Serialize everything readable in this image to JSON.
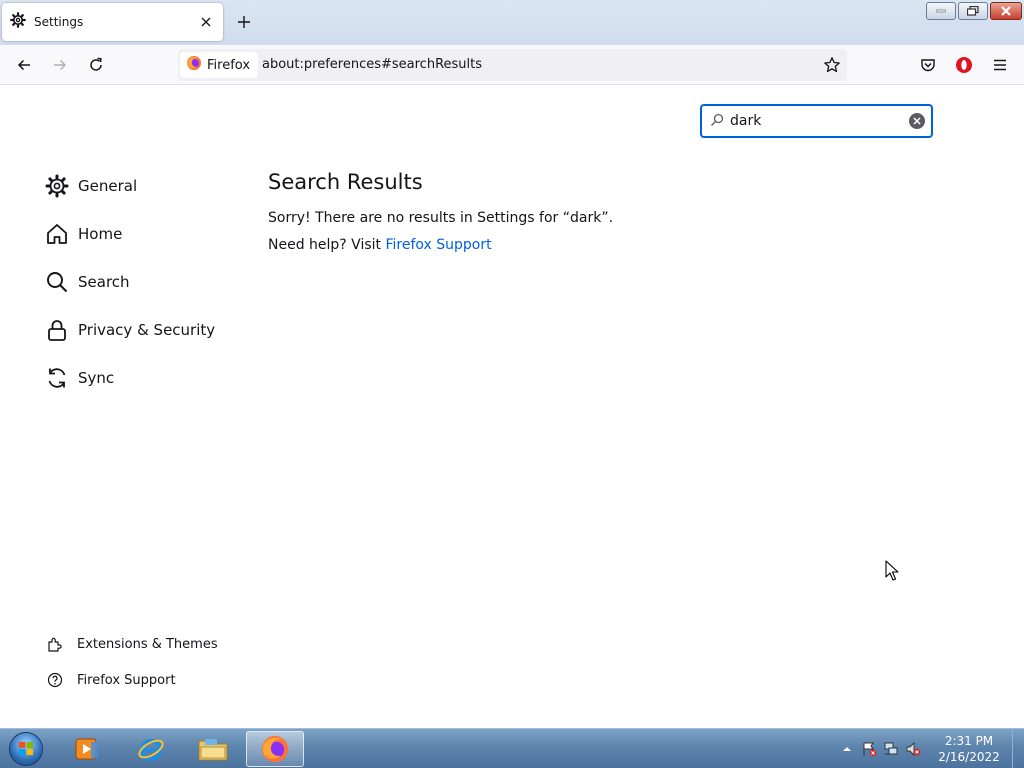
{
  "tab": {
    "title": "Settings",
    "icon": "gear-icon"
  },
  "toolbar": {
    "identity_label": "Firefox",
    "url": "about:preferences#searchResults"
  },
  "search": {
    "value": "dark"
  },
  "sidebar": {
    "items": [
      {
        "label": "General",
        "icon": "gear-icon"
      },
      {
        "label": "Home",
        "icon": "home-icon"
      },
      {
        "label": "Search",
        "icon": "magnifier-icon"
      },
      {
        "label": "Privacy & Security",
        "icon": "lock-icon"
      },
      {
        "label": "Sync",
        "icon": "sync-icon"
      }
    ],
    "footer": [
      {
        "label": "Extensions & Themes",
        "icon": "puzzle-icon"
      },
      {
        "label": "Firefox Support",
        "icon": "help-icon"
      }
    ]
  },
  "results": {
    "heading": "Search Results",
    "sorry": "Sorry! There are no results in Settings for “dark”.",
    "help_prefix": "Need help? Visit ",
    "help_link": "Firefox Support"
  },
  "taskbar": {
    "apps": [
      "media-player-icon",
      "internet-explorer-icon",
      "file-explorer-icon",
      "firefox-icon"
    ],
    "time": "2:31 PM",
    "date": "2/16/2022"
  }
}
